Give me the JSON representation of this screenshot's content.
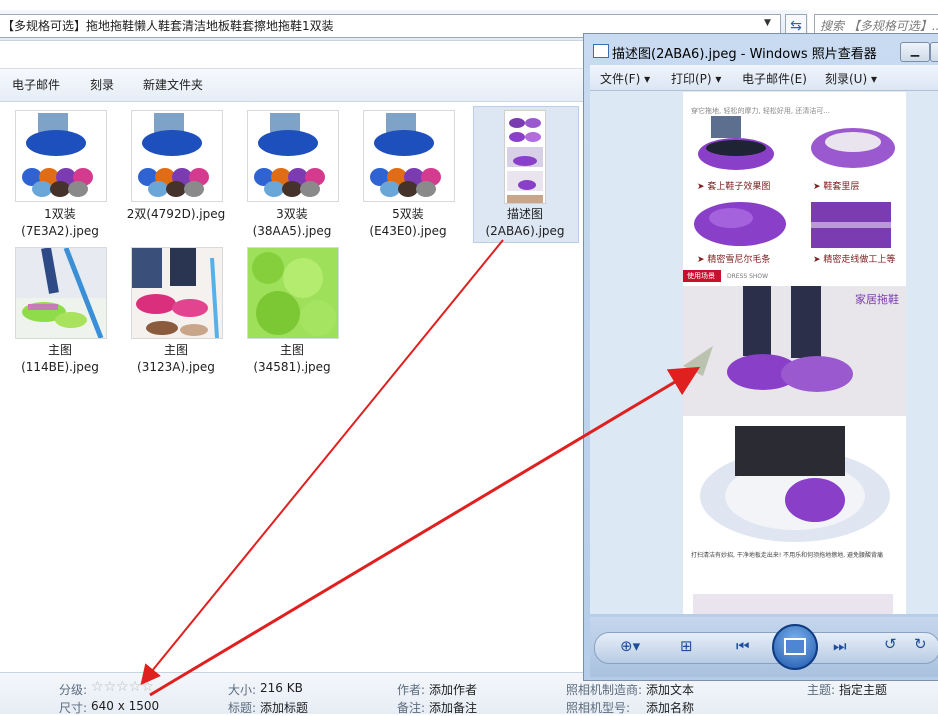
{
  "address_bar": {
    "path": "【多规格可选】拖地拖鞋懒人鞋套清洁地板鞋套擦地拖鞋1双装",
    "search_placeholder": "搜索 【多规格可选】..."
  },
  "toolbar": {
    "items": [
      "电子邮件",
      "刻录",
      "新建文件夹"
    ]
  },
  "files": [
    {
      "name_line1": "1双装",
      "name_line2": "(7E3A2).jpeg"
    },
    {
      "name_line1": "2双(4792D).jpeg",
      "name_line2": ""
    },
    {
      "name_line1": "3双装",
      "name_line2": "(38AA5).jpeg"
    },
    {
      "name_line1": "5双装",
      "name_line2": "(E43E0).jpeg"
    },
    {
      "name_line1": "描述图",
      "name_line2": "(2ABA6).jpeg"
    },
    {
      "name_line1": "主图",
      "name_line2": "(114BE).jpeg"
    },
    {
      "name_line1": "主图",
      "name_line2": "(3123A).jpeg"
    },
    {
      "name_line1": "主图",
      "name_line2": "(34581).jpeg"
    }
  ],
  "status_bar": {
    "rating_label": "分级:",
    "size_dim_label": "尺寸:",
    "size_dim_value": "640 x 1500",
    "filesize_label": "大小:",
    "filesize_value": "216 KB",
    "title_label": "标题:",
    "title_value": "添加标题",
    "author_label": "作者:",
    "author_value": "添加作者",
    "note_label": "备注:",
    "note_value": "添加备注",
    "maker_label": "照相机制造商:",
    "maker_value": "添加文本",
    "model_label": "照相机型号:",
    "model_value": "添加名称",
    "subject_label": "主题:",
    "subject_value": "指定主题",
    "rating_stars": 0
  },
  "viewer": {
    "title": "描述图(2ABA6).jpeg - Windows 照片查看器",
    "menu": [
      "文件(F)",
      "打印(P)",
      "电子邮件(E)",
      "刻录(U)"
    ],
    "image_texts": {
      "top_caption": "穿它拖地, 轻松的摩力, 轻松好用, 还清洁可...",
      "cap1": "套上鞋子效果图",
      "cap2": "鞋套里层",
      "cap3": "精密雪尼尔毛条",
      "cap4": "精密走线做工上等",
      "section_tag": "使用场景",
      "section_sub": "DRESS SHOW",
      "banner": "家居拖鞋",
      "bottom_caption": "打扫清洁有妙招, 干净地板走出来! 不用乐和何须拖地擦地, 避免腰酸背痛"
    }
  },
  "colors": {
    "arrow": "#e0201f",
    "purple": "#8a3fc9",
    "accent_blue": "#2a63b8"
  }
}
